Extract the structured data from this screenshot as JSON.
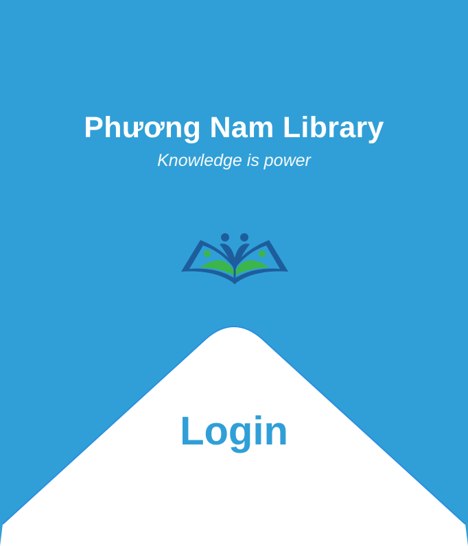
{
  "header": {
    "title": "Phương Nam Library",
    "tagline": "Knowledge is power"
  },
  "logo": {
    "icon": "book-readers-icon"
  },
  "login": {
    "label": "Login"
  },
  "colors": {
    "background": "#309fd7",
    "panel": "#ffffff",
    "accent": "#309fd7",
    "logo_dark": "#1e5d9c",
    "logo_green": "#3cb64a"
  }
}
